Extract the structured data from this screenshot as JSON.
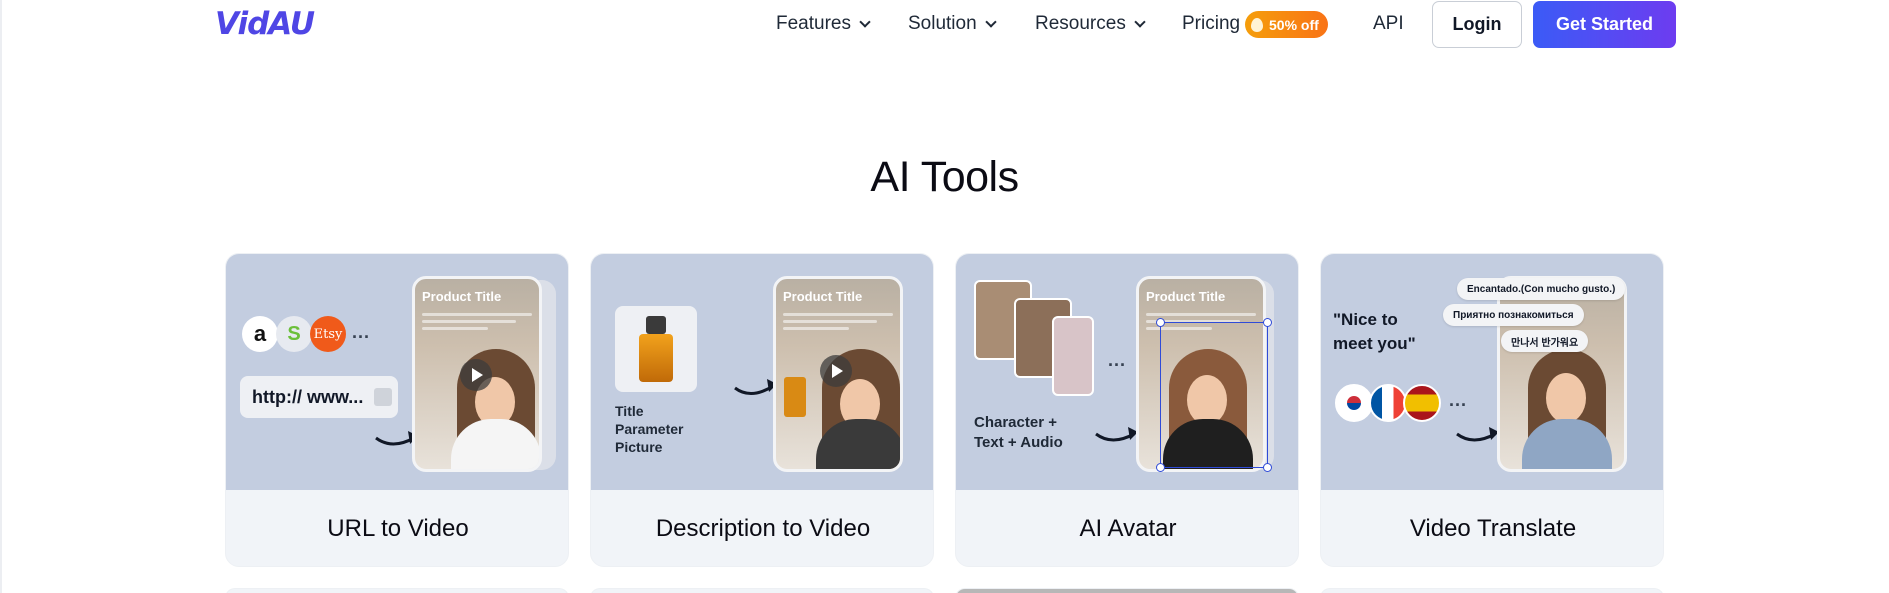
{
  "header": {
    "logo": "VidAU",
    "nav": [
      {
        "label": "Features",
        "has_dropdown": true
      },
      {
        "label": "Solution",
        "has_dropdown": true
      },
      {
        "label": "Resources",
        "has_dropdown": true
      },
      {
        "label": "Pricing",
        "has_dropdown": false
      },
      {
        "label": "API",
        "has_dropdown": false
      }
    ],
    "pricing_badge": "50% off",
    "login_label": "Login",
    "cta_label": "Get Started"
  },
  "section": {
    "title": "AI Tools"
  },
  "cards": [
    {
      "label": "URL to Video",
      "phone_title": "Product Title",
      "url_text": "http:// www...",
      "store_logos": [
        "a",
        "S",
        "Etsy"
      ],
      "ellipsis": "..."
    },
    {
      "label": "Description to Video",
      "phone_title": "Product Title",
      "inputs": [
        "Title",
        "Parameter",
        "Picture"
      ]
    },
    {
      "label": "AI Avatar",
      "phone_title": "Product Title",
      "caption_line1": "Character +",
      "caption_line2": "Text + Audio",
      "ellipsis": "..."
    },
    {
      "label": "Video Translate",
      "quote_line1": "\"Nice to",
      "quote_line2": "meet you\"",
      "bubbles": [
        "Encantado.(Con mucho gusto.)",
        "Приятно познакомиться",
        "만나서 반가워요"
      ],
      "ellipsis": "..."
    }
  ],
  "colors": {
    "brand": "#4f46e5",
    "cta_start": "#3b5bf6",
    "cta_end": "#6d3cf0",
    "badge": "#f59e0b",
    "thumb_bg": "#c3cde0",
    "card_bg": "#f1f4f8"
  }
}
